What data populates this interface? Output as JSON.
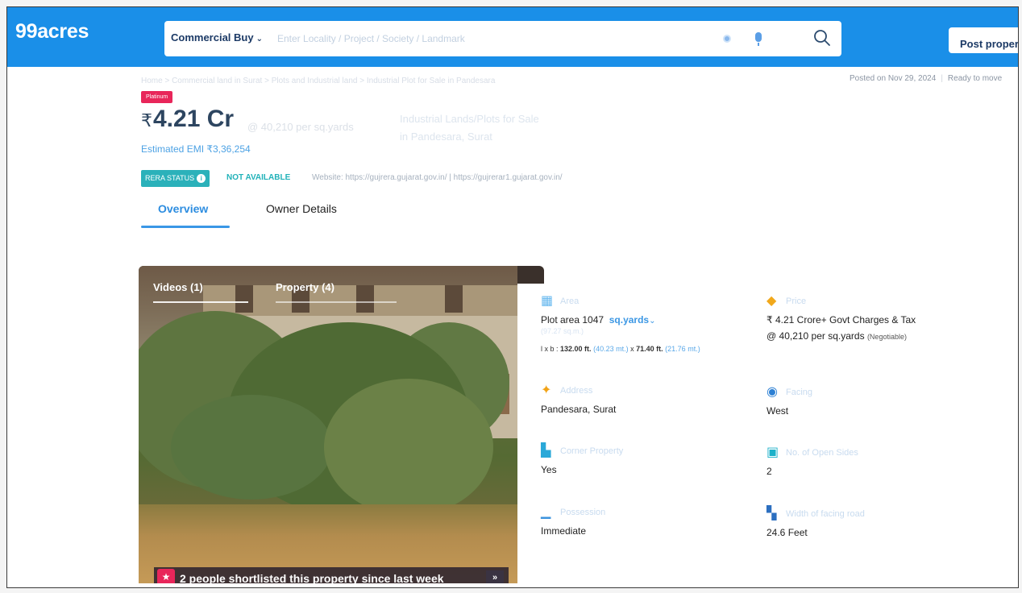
{
  "header": {
    "logo": "99acres",
    "category": "Commercial Buy",
    "search_placeholder": "Enter Locality / Project / Society / Landmark",
    "post_button": "Post property"
  },
  "breadcrumb": "Home > Commercial land in Surat > Plots and Industrial land > Industrial Plot for Sale in Pandesara",
  "posted": {
    "date": "Posted on Nov 29, 2024",
    "status": "Ready to move"
  },
  "listing": {
    "badge": "Platinum",
    "currency": "₹",
    "price": "4.21 Cr",
    "per_unit": "@ 40,210 per sq.yards",
    "title_line1": "Industrial Lands/Plots for Sale",
    "title_line2": "in Pandesara, Surat",
    "emi": "Estimated EMI ₹3,36,254"
  },
  "rera": {
    "label": "RERA STATUS",
    "value": "NOT AVAILABLE",
    "website": "Website: https://gujrera.gujarat.gov.in/ | https://gujrerar1.gujarat.gov.in/"
  },
  "tabs": [
    "Overview",
    "Owner Details"
  ],
  "gallery": {
    "tabs": [
      "Videos (1)",
      "Property (4)"
    ],
    "shortlist": "2 people shortlisted this property since last week"
  },
  "details": {
    "area": {
      "label": "Area",
      "value_prefix": "Plot area 1047",
      "unit": "sq.yards",
      "faint": "(97.27 sq.m.)",
      "dims_lxb": "l x b :",
      "dims_l": "132.00 ft.",
      "dims_l_m": "(40.23 mt.)",
      "dims_x": "x",
      "dims_b": "71.40 ft.",
      "dims_b_m": "(21.76 mt.)"
    },
    "price": {
      "label": "Price",
      "value": "₹ 4.21 Crore+ Govt Charges & Tax",
      "per": "@ 40,210 per sq.yards",
      "negotiable": "(Negotiable)"
    },
    "address": {
      "label": "Address",
      "value": "Pandesara, Surat"
    },
    "facing": {
      "label": "Facing",
      "value": "West"
    },
    "corner": {
      "label": "Corner Property",
      "value": "Yes"
    },
    "open_sides": {
      "label": "No. of Open Sides",
      "value": "2"
    },
    "possession": {
      "label": "Possession",
      "value": "Immediate"
    },
    "road_width": {
      "label": "Width of facing road",
      "value": "24.6 Feet"
    }
  }
}
